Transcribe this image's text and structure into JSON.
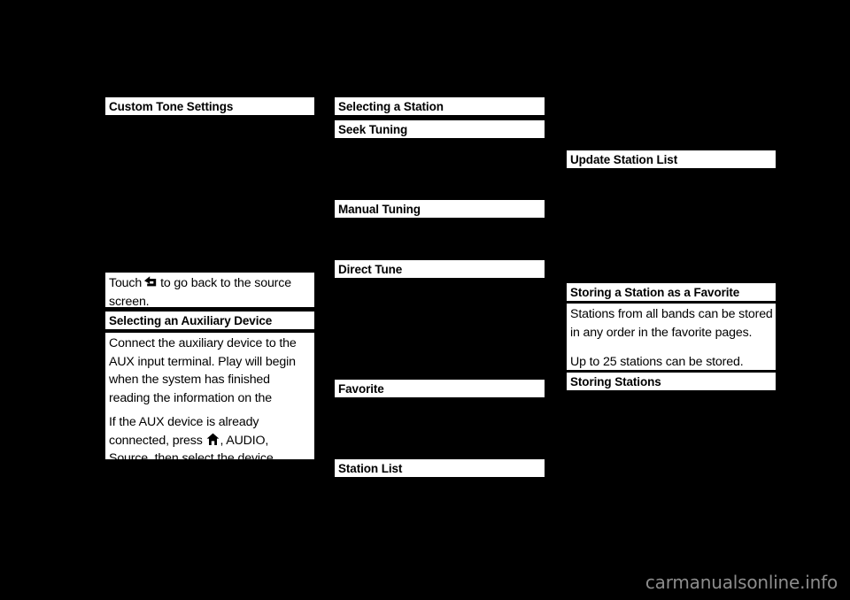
{
  "page": {
    "background_color": "#000000",
    "text_block_color": "#ffffff",
    "text_color": "#000000",
    "watermark": "carmanualsonline.info",
    "watermark_color": "#8d8d8d"
  },
  "columns": {
    "left": {
      "heading_custom_tone": "Custom Tone Settings",
      "touch_back_pre": "Touch",
      "touch_back_post": "to go back to the source screen.",
      "heading_selecting_aux": "Selecting an Auxiliary Device",
      "body_connect_aux": "Connect the auxiliary device to the AUX input terminal. Play will begin when the system has finished reading the information on the device.",
      "body_already_connected_pre": "If the AUX device is already connected, press",
      "body_already_connected_post": ", AUDIO, Source, then select the device."
    },
    "middle": {
      "heading_selecting_station": "Selecting a Station",
      "heading_seek_tuning": "Seek Tuning",
      "heading_manual_tuning": "Manual Tuning",
      "heading_direct_tune": "Direct Tune",
      "heading_favorite": "Favorite",
      "heading_station_list": "Station List"
    },
    "right": {
      "heading_update_station_list": "Update Station List",
      "heading_storing_favorite": "Storing a Station as a Favorite",
      "body_stations_all_bands": "Stations from all bands can be stored in any order in the favorite pages.",
      "body_up_to_25": "Up to 25 stations can be stored.",
      "heading_storing_stations": "Storing Stations"
    }
  },
  "icons": {
    "return_arrow": "return-arrow-icon",
    "home": "home-icon"
  }
}
